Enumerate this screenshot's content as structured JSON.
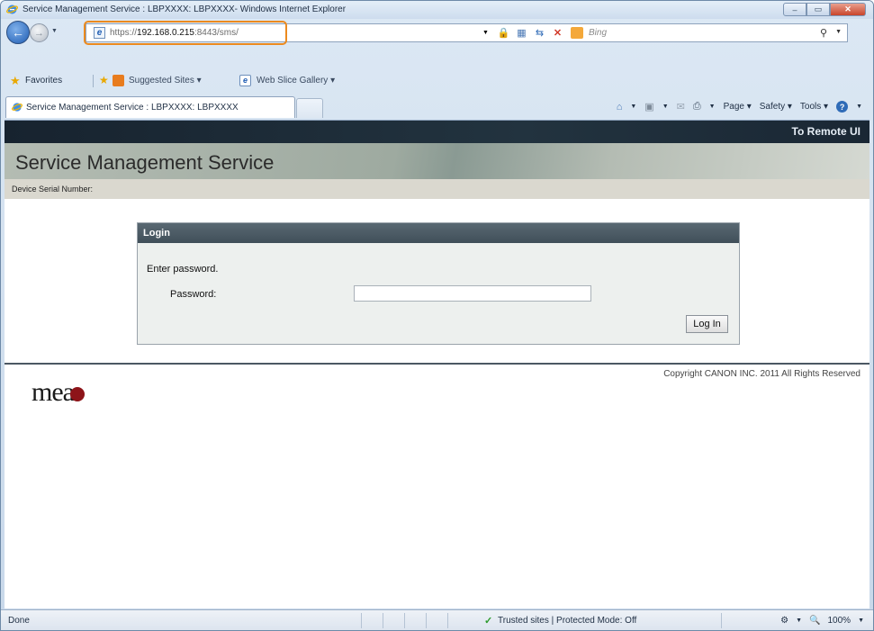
{
  "window": {
    "title": "Service Management Service : LBPXXXX: LBPXXXX- Windows Internet Explorer",
    "minimize_glyph": "–",
    "maximize_glyph": "▭",
    "close_glyph": "✕"
  },
  "addressbar": {
    "url_prefix": "https://",
    "url_host": "192.168.0.215",
    "url_suffix": ":8443/sms/",
    "search_placeholder": "Bing",
    "accent_color": "#ec8a1e"
  },
  "favorites": {
    "label": "Favorites",
    "items": [
      {
        "label": "Suggested Sites ▾"
      },
      {
        "label": "Web Slice Gallery ▾"
      }
    ]
  },
  "tab": {
    "label": "Service Management Service : LBPXXXX: LBPXXXX"
  },
  "commandbar": {
    "page": "Page ▾",
    "safety": "Safety ▾",
    "tools": "Tools ▾"
  },
  "page": {
    "remote_link": "To Remote UI",
    "header_title": "Service Management Service",
    "serial_label": "Device Serial Number:",
    "login": {
      "title": "Login",
      "prompt": "Enter password.",
      "password_label": "Password:",
      "password_value": "",
      "button": "Log In"
    },
    "copyright": "Copyright CANON INC. 2011 All Rights Reserved",
    "logo_text": "mea"
  },
  "statusbar": {
    "status": "Done",
    "zone": "Trusted sites | Protected Mode: Off",
    "zoom": "100%"
  }
}
